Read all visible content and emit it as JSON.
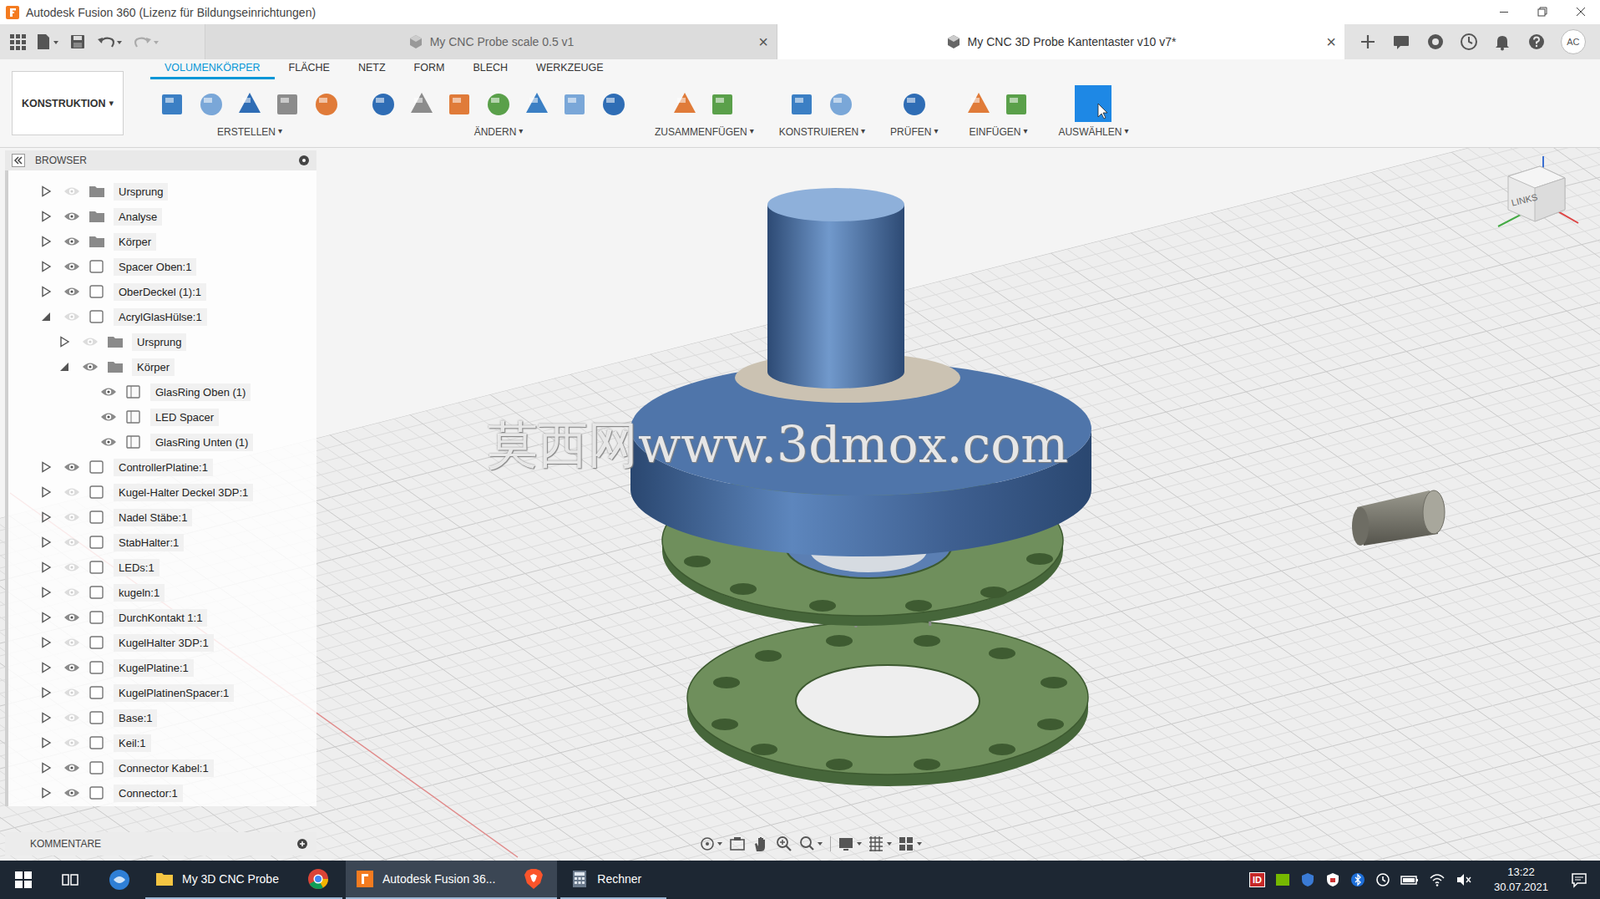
{
  "window": {
    "title": "Autodesk Fusion 360 (Lizenz für Bildungseinrichtungen)"
  },
  "doc_tabs": [
    {
      "label": "My CNC Probe scale 0.5 v1",
      "selected": false,
      "close": "×"
    },
    {
      "label": "My CNC 3D Probe Kantentaster v10 v7*",
      "selected": true,
      "close": "×"
    }
  ],
  "user": {
    "initials": "AC"
  },
  "workspace": {
    "label": "KONSTRUKTION",
    "arrow": "▾"
  },
  "toolbar_tabs": [
    {
      "label": "VOLUMENKÖRPER",
      "selected": true
    },
    {
      "label": "FLÄCHE",
      "selected": false
    },
    {
      "label": "NETZ",
      "selected": false
    },
    {
      "label": "FORM",
      "selected": false
    },
    {
      "label": "BLECH",
      "selected": false
    },
    {
      "label": "WERKZEUGE",
      "selected": false
    }
  ],
  "tool_groups": [
    {
      "label": "ERSTELLEN",
      "arrow": "▾"
    },
    {
      "label": "ÄNDERN",
      "arrow": "▾"
    },
    {
      "label": "ZUSAMMENFÜGEN",
      "arrow": "▾"
    },
    {
      "label": "KONSTRUIEREN",
      "arrow": "▾"
    },
    {
      "label": "PRÜFEN",
      "arrow": "▾"
    },
    {
      "label": "EINFÜGEN",
      "arrow": "▾"
    },
    {
      "label": "AUSWÄHLEN",
      "arrow": "▾"
    }
  ],
  "browser": {
    "title": "BROWSER",
    "items": [
      {
        "label": "Ursprung",
        "level": 0,
        "kind": "folder",
        "has_children": true,
        "expanded": false,
        "visible": false
      },
      {
        "label": "Analyse",
        "level": 0,
        "kind": "folder",
        "has_children": true,
        "expanded": false,
        "visible": true
      },
      {
        "label": "Körper",
        "level": 0,
        "kind": "folder",
        "has_children": true,
        "expanded": false,
        "visible": true
      },
      {
        "label": "Spacer Oben:1",
        "level": 0,
        "kind": "component",
        "has_children": true,
        "expanded": false,
        "visible": true
      },
      {
        "label": "OberDeckel (1):1",
        "level": 0,
        "kind": "component",
        "has_children": true,
        "expanded": false,
        "visible": true
      },
      {
        "label": "AcrylGlasHülse:1",
        "level": 0,
        "kind": "component",
        "has_children": true,
        "expanded": true,
        "visible": false
      },
      {
        "label": "Ursprung",
        "level": 1,
        "kind": "folder",
        "has_children": true,
        "expanded": false,
        "visible": false
      },
      {
        "label": "Körper",
        "level": 1,
        "kind": "folder",
        "has_children": true,
        "expanded": true,
        "visible": true
      },
      {
        "label": "GlasRing Oben (1)",
        "level": 2,
        "kind": "body",
        "has_children": false,
        "expanded": false,
        "visible": true
      },
      {
        "label": "LED Spacer",
        "level": 2,
        "kind": "body",
        "has_children": false,
        "expanded": false,
        "visible": true
      },
      {
        "label": "GlasRing Unten (1)",
        "level": 2,
        "kind": "body",
        "has_children": false,
        "expanded": false,
        "visible": true
      },
      {
        "label": "ControllerPlatine:1",
        "level": 0,
        "kind": "component",
        "has_children": true,
        "expanded": false,
        "visible": true
      },
      {
        "label": "Kugel-Halter Deckel 3DP:1",
        "level": 0,
        "kind": "component",
        "has_children": true,
        "expanded": false,
        "visible": false
      },
      {
        "label": "Nadel Stäbe:1",
        "level": 0,
        "kind": "component",
        "has_children": true,
        "expanded": false,
        "visible": false
      },
      {
        "label": "StabHalter:1",
        "level": 0,
        "kind": "component",
        "has_children": true,
        "expanded": false,
        "visible": false
      },
      {
        "label": "LEDs:1",
        "level": 0,
        "kind": "component",
        "has_children": true,
        "expanded": false,
        "visible": false
      },
      {
        "label": "kugeln:1",
        "level": 0,
        "kind": "component",
        "has_children": true,
        "expanded": false,
        "visible": false
      },
      {
        "label": "DurchKontakt 1:1",
        "level": 0,
        "kind": "component",
        "has_children": true,
        "expanded": false,
        "visible": true
      },
      {
        "label": "KugelHalter 3DP:1",
        "level": 0,
        "kind": "component",
        "has_children": true,
        "expanded": false,
        "visible": false
      },
      {
        "label": "KugelPlatine:1",
        "level": 0,
        "kind": "component",
        "has_children": true,
        "expanded": false,
        "visible": true
      },
      {
        "label": "KugelPlatinenSpacer:1",
        "level": 0,
        "kind": "component",
        "has_children": true,
        "expanded": false,
        "visible": false
      },
      {
        "label": "Base:1",
        "level": 0,
        "kind": "component",
        "has_children": true,
        "expanded": false,
        "visible": false
      },
      {
        "label": "Keil:1",
        "level": 0,
        "kind": "component",
        "has_children": true,
        "expanded": false,
        "visible": false
      },
      {
        "label": "Connector Kabel:1",
        "level": 0,
        "kind": "component",
        "has_children": true,
        "expanded": false,
        "visible": true
      },
      {
        "label": "Connector:1",
        "level": 0,
        "kind": "component",
        "has_children": true,
        "expanded": false,
        "visible": true
      }
    ]
  },
  "comments": {
    "title": "KOMMENTARE"
  },
  "viewcube": {
    "face": "LINKS"
  },
  "watermark": "莫西网www.3dmox.com",
  "taskbar": {
    "items": [
      {
        "label": "My 3D CNC Probe",
        "selected": false
      },
      {
        "label": "Autodesk Fusion 36...",
        "selected": true
      },
      {
        "label": "Rechner",
        "selected": false
      }
    ],
    "tray_badge": "ID",
    "time": "13:22",
    "date": "30.07.2021"
  }
}
